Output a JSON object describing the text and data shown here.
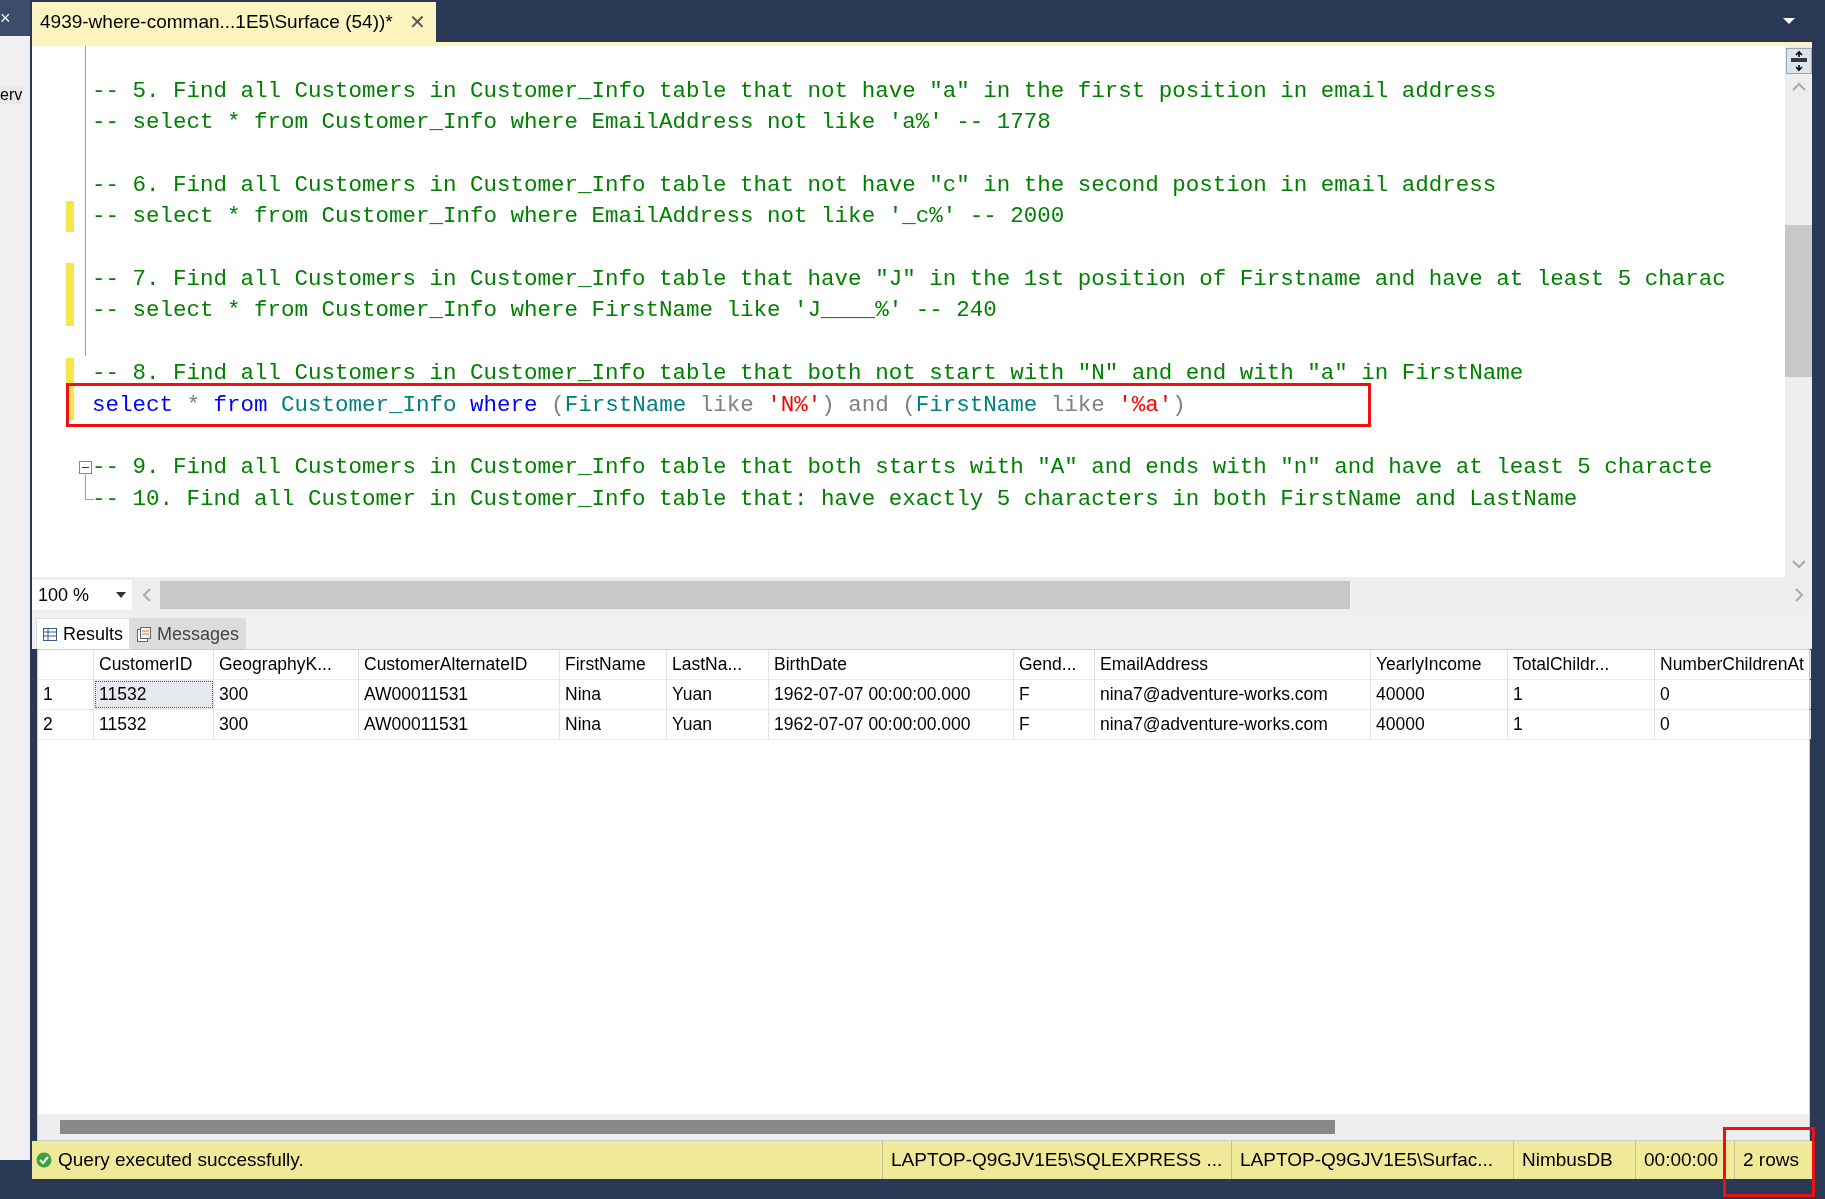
{
  "side_panel": {
    "close": "×",
    "text": "erv"
  },
  "document_tab": {
    "title": "4939-where-comman...1E5\\Surface (54))*",
    "close": "✕",
    "selected": true
  },
  "editor": {
    "blocks": [
      {
        "lines": [
          {
            "modified": false,
            "boxed": false,
            "fold_toggle": false,
            "tokens": [
              {
                "kind": "comment",
                "text": "-- 5. Find all Customers in Customer_Info table that not have \"a\" in the first position in email address"
              }
            ]
          },
          {
            "modified": false,
            "boxed": false,
            "fold_toggle": false,
            "tokens": [
              {
                "kind": "comment",
                "text": "-- select * from Customer_Info where EmailAddress not like 'a%' -- 1778"
              }
            ]
          }
        ]
      },
      {
        "lines": [
          {
            "modified": false,
            "boxed": false,
            "fold_toggle": false,
            "tokens": [
              {
                "kind": "comment",
                "text": "-- 6. Find all Customers in Customer_Info table that not have \"c\" in the second postion in email address"
              }
            ]
          },
          {
            "modified": true,
            "boxed": false,
            "fold_toggle": false,
            "tokens": [
              {
                "kind": "comment",
                "text": "-- select * from Customer_Info where EmailAddress not like '_c%' -- 2000"
              }
            ]
          }
        ]
      },
      {
        "lines": [
          {
            "modified": true,
            "boxed": false,
            "fold_toggle": false,
            "tokens": [
              {
                "kind": "comment",
                "text": "-- 7. Find all Customers in Customer_Info table that have \"J\" in the 1st position of Firstname and have at least 5 charac"
              }
            ]
          },
          {
            "modified": true,
            "boxed": false,
            "fold_toggle": false,
            "tokens": [
              {
                "kind": "comment",
                "text": "-- select * from Customer_Info where FirstName like 'J____%' -- 240"
              }
            ]
          }
        ]
      },
      {
        "lines": [
          {
            "modified": true,
            "boxed": false,
            "fold_toggle": false,
            "tokens": [
              {
                "kind": "comment",
                "text": "-- 8. Find all Customers in Customer_Info table that both not start with \"N\" and end with \"a\" in FirstName"
              }
            ]
          },
          {
            "modified": true,
            "boxed": true,
            "fold_toggle": false,
            "tokens": [
              {
                "kind": "keyword",
                "text": "select"
              },
              {
                "kind": "operator",
                "text": " * "
              },
              {
                "kind": "keyword",
                "text": "from"
              },
              {
                "kind": "identifier",
                "text": " Customer_Info "
              },
              {
                "kind": "keyword",
                "text": "where"
              },
              {
                "kind": "operator",
                "text": " ("
              },
              {
                "kind": "identifier",
                "text": "FirstName"
              },
              {
                "kind": "operator",
                "text": " like "
              },
              {
                "kind": "string",
                "text": "'N%'"
              },
              {
                "kind": "operator",
                "text": ") and ("
              },
              {
                "kind": "identifier",
                "text": "FirstName"
              },
              {
                "kind": "operator",
                "text": " like "
              },
              {
                "kind": "string",
                "text": "'%a'"
              },
              {
                "kind": "operator",
                "text": ")"
              }
            ]
          }
        ]
      },
      {
        "lines": [
          {
            "modified": false,
            "boxed": false,
            "fold_toggle": true,
            "tokens": [
              {
                "kind": "comment",
                "text": "-- 9. Find all Customers in Customer_Info table that both starts with \"A\" and ends with \"n\" and have at least 5 characte"
              }
            ]
          },
          {
            "modified": false,
            "boxed": false,
            "fold_toggle": false,
            "tokens": [
              {
                "kind": "comment",
                "text": "-- 10. Find all Customer in Customer_Info table that: have exactly 5 characters in both FirstName and LastName"
              }
            ]
          }
        ]
      }
    ]
  },
  "zoom": {
    "value": "100 %"
  },
  "result_tabs": [
    {
      "label": "Results",
      "selected": true
    },
    {
      "label": "Messages",
      "selected": false
    }
  ],
  "grid": {
    "columns": [
      "CustomerID",
      "GeographyK...",
      "CustomerAlternateID",
      "FirstName",
      "LastNa...",
      "BirthDate",
      "Gend...",
      "EmailAddress",
      "YearlyIncome",
      "TotalChildr...",
      "NumberChildrenAt"
    ],
    "rows": [
      {
        "number": "1",
        "cells": [
          {
            "text": "11532",
            "selected": true
          },
          {
            "text": "300",
            "selected": false
          },
          {
            "text": "AW00011531",
            "selected": false
          },
          {
            "text": "Nina",
            "selected": false
          },
          {
            "text": "Yuan",
            "selected": false
          },
          {
            "text": "1962-07-07 00:00:00.000",
            "selected": false
          },
          {
            "text": "F",
            "selected": false
          },
          {
            "text": "nina7@adventure-works.com",
            "selected": false
          },
          {
            "text": "40000",
            "selected": false
          },
          {
            "text": "1",
            "selected": false
          },
          {
            "text": "0",
            "selected": false
          }
        ]
      },
      {
        "number": "2",
        "cells": [
          {
            "text": "11532",
            "selected": false
          },
          {
            "text": "300",
            "selected": false
          },
          {
            "text": "AW00011531",
            "selected": false
          },
          {
            "text": "Nina",
            "selected": false
          },
          {
            "text": "Yuan",
            "selected": false
          },
          {
            "text": "1962-07-07 00:00:00.000",
            "selected": false
          },
          {
            "text": "F",
            "selected": false
          },
          {
            "text": "nina7@adventure-works.com",
            "selected": false
          },
          {
            "text": "40000",
            "selected": false
          },
          {
            "text": "1",
            "selected": false
          },
          {
            "text": "0",
            "selected": false
          }
        ]
      }
    ]
  },
  "status_bar": {
    "message": "Query executed successfully.",
    "segments": [
      {
        "text": "LAPTOP-Q9GJV1E5\\SQLEXPRESS ...",
        "boxed": false
      },
      {
        "text": "LAPTOP-Q9GJV1E5\\Surfac...",
        "boxed": false
      },
      {
        "text": "NimbusDB",
        "boxed": false
      },
      {
        "text": "00:00:00",
        "boxed": false
      },
      {
        "text": "2 rows",
        "boxed": true
      }
    ]
  }
}
